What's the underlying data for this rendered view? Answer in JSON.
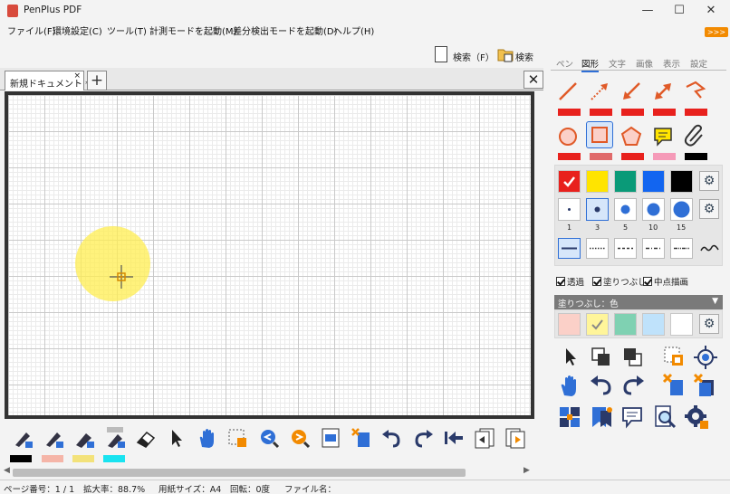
{
  "window": {
    "title": "PenPlus PDF",
    "minimize": "—",
    "maximize": "☐",
    "close": "✕"
  },
  "menu": {
    "items": [
      "ファイル(F)",
      "環境設定(C)",
      "ツール(T)",
      "計測モードを起動(M)",
      "差分検出モードを起動(D)",
      "ヘルプ(H)"
    ],
    "badge": ">>>"
  },
  "search": {
    "label1": "検索（F）",
    "label2": "検索"
  },
  "tabs": {
    "document": "新規ドキュメント *",
    "close_glyph": "×",
    "add_glyph": "+",
    "close_all_glyph": "✕"
  },
  "bottom": {
    "swatches": [
      "#000000",
      "#f5b5a8",
      "#f3e27a",
      "#19e3f0"
    ]
  },
  "status": {
    "page": "ページ番号：1 / 1",
    "zoom": "拡大率：88.7%",
    "paper": "用紙サイズ：A4",
    "rotation": "回転：0度",
    "filename": "ファイル名："
  },
  "panel": {
    "tabs": [
      "ペン",
      "図形",
      "文字",
      "画像",
      "表示",
      "設定"
    ],
    "active_tab": "図形",
    "colors": {
      "red": "#e8211d",
      "yellow": "#ffe400",
      "green": "#0a9a78",
      "blue": "#1265f0",
      "black": "#000000",
      "accent": "#2f6fd6"
    },
    "line_widths": [
      "1",
      "3",
      "5",
      "10",
      "15"
    ],
    "checks": {
      "transparent": "透過",
      "fill": "塗りつぶし",
      "center": "中点描画"
    },
    "fill_select": "塗りつぶし：色",
    "fill_colors": [
      "#fbd0c8",
      "#fff59a",
      "#7fd1b2",
      "#bfe2fb",
      "#ffffff"
    ]
  }
}
